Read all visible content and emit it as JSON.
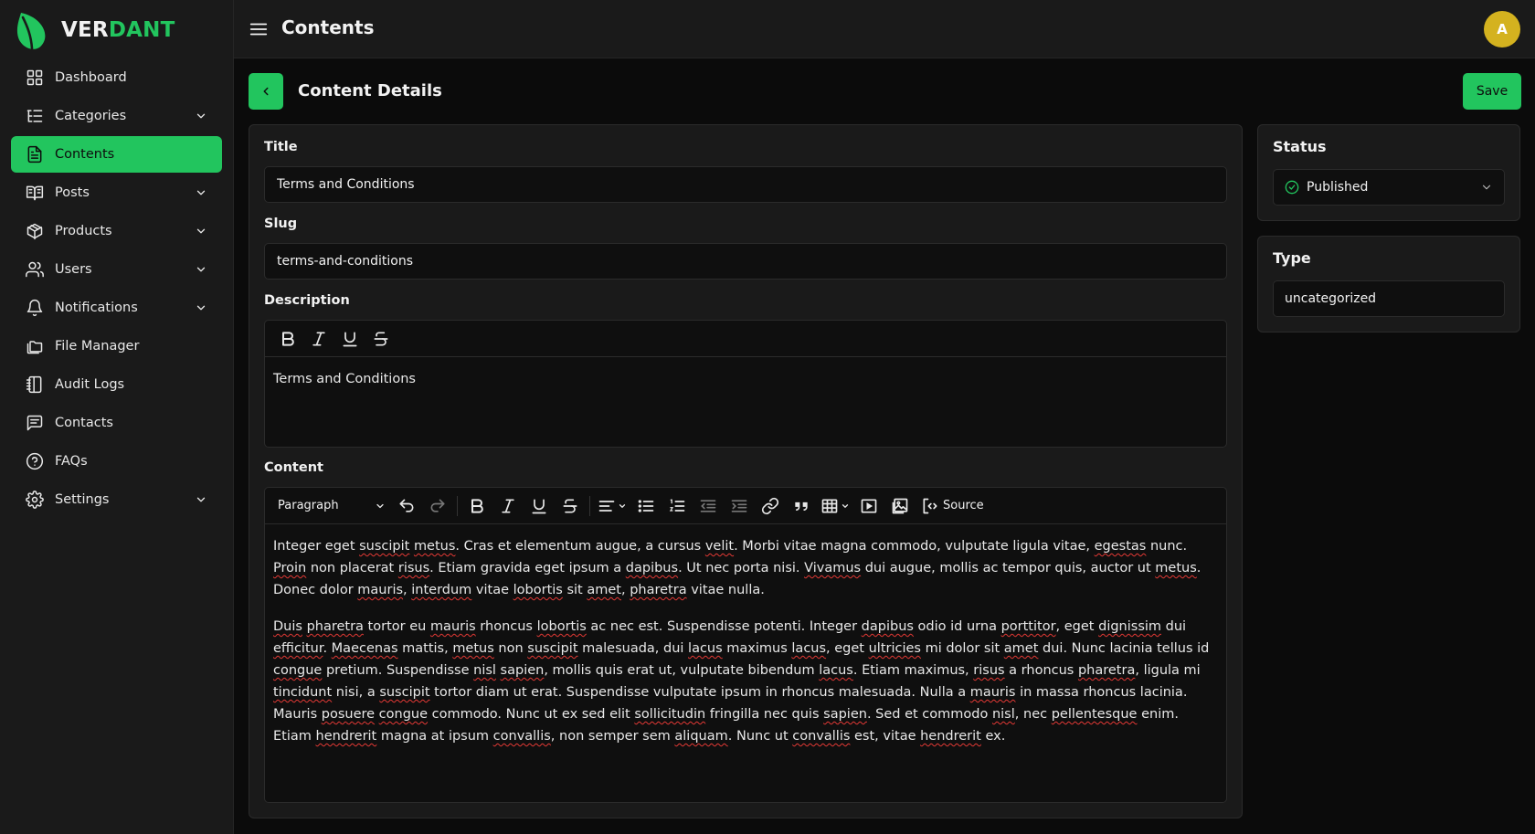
{
  "brand": {
    "prefix": "VER",
    "suffix": "DANT"
  },
  "sidebar": {
    "items": [
      {
        "label": "Dashboard",
        "icon": "grid-icon",
        "expandable": false,
        "active": false
      },
      {
        "label": "Categories",
        "icon": "list-tree-icon",
        "expandable": true,
        "active": false
      },
      {
        "label": "Contents",
        "icon": "file-text-icon",
        "expandable": false,
        "active": true
      },
      {
        "label": "Posts",
        "icon": "book-open-icon",
        "expandable": true,
        "active": false
      },
      {
        "label": "Products",
        "icon": "package-icon",
        "expandable": true,
        "active": false
      },
      {
        "label": "Users",
        "icon": "users-icon",
        "expandable": true,
        "active": false
      },
      {
        "label": "Notifications",
        "icon": "bell-icon",
        "expandable": true,
        "active": false
      },
      {
        "label": "File Manager",
        "icon": "folders-icon",
        "expandable": false,
        "active": false
      },
      {
        "label": "Audit Logs",
        "icon": "notebook-icon",
        "expandable": false,
        "active": false
      },
      {
        "label": "Contacts",
        "icon": "message-square-icon",
        "expandable": false,
        "active": false
      },
      {
        "label": "FAQs",
        "icon": "help-circle-icon",
        "expandable": false,
        "active": false
      },
      {
        "label": "Settings",
        "icon": "gear-icon",
        "expandable": true,
        "active": false
      }
    ]
  },
  "header": {
    "title": "Contents",
    "avatar_initial": "A"
  },
  "page": {
    "section_title": "Content Details",
    "save_label": "Save"
  },
  "form": {
    "title_label": "Title",
    "title_value": "Terms and Conditions",
    "slug_label": "Slug",
    "slug_value": "terms-and-conditions",
    "description_label": "Description",
    "description_value": "Terms and Conditions",
    "content_label": "Content",
    "paragraph_style": "Paragraph",
    "source_label": "Source",
    "content_paragraphs": [
      [
        [
          "Integer eget ",
          false
        ],
        [
          "suscipit",
          true
        ],
        [
          " ",
          false
        ],
        [
          "metus",
          true
        ],
        [
          ". Cras et elementum augue, a cursus ",
          false
        ],
        [
          "velit",
          true
        ],
        [
          ". Morbi vitae magna commodo, vulputate ligula vitae, ",
          false
        ],
        [
          "egestas",
          true
        ],
        [
          " nunc. ",
          false
        ],
        [
          "Proin",
          true
        ],
        [
          " non placerat ",
          false
        ],
        [
          "risus",
          true
        ],
        [
          ". Etiam gravida eget ipsum a ",
          false
        ],
        [
          "dapibus",
          true
        ],
        [
          ". Ut nec porta nisi. ",
          false
        ],
        [
          "Vivamus",
          true
        ],
        [
          " dui augue, mollis ac tempor quis, auctor ut ",
          false
        ],
        [
          "metus",
          true
        ],
        [
          ". Donec dolor ",
          false
        ],
        [
          "mauris",
          true
        ],
        [
          ", ",
          false
        ],
        [
          "interdum",
          true
        ],
        [
          " vitae ",
          false
        ],
        [
          "lobortis",
          true
        ],
        [
          " sit ",
          false
        ],
        [
          "amet",
          true
        ],
        [
          ", ",
          false
        ],
        [
          "pharetra",
          true
        ],
        [
          " vitae nulla.",
          false
        ]
      ],
      [
        [
          "Duis",
          true
        ],
        [
          " ",
          false
        ],
        [
          "pharetra",
          true
        ],
        [
          " tortor eu ",
          false
        ],
        [
          "mauris",
          true
        ],
        [
          " rhoncus ",
          false
        ],
        [
          "lobortis",
          true
        ],
        [
          " ac nec est. Suspendisse potenti. Integer ",
          false
        ],
        [
          "dapibus",
          true
        ],
        [
          " odio id urna ",
          false
        ],
        [
          "porttitor",
          true
        ],
        [
          ", eget ",
          false
        ],
        [
          "dignissim",
          true
        ],
        [
          " dui ",
          false
        ],
        [
          "efficitur",
          true
        ],
        [
          ". ",
          false
        ],
        [
          "Maecenas",
          true
        ],
        [
          " mattis, ",
          false
        ],
        [
          "metus",
          true
        ],
        [
          " non ",
          false
        ],
        [
          "suscipit",
          true
        ],
        [
          " malesuada, dui ",
          false
        ],
        [
          "lacus",
          true
        ],
        [
          " maximus ",
          false
        ],
        [
          "lacus",
          true
        ],
        [
          ", eget ",
          false
        ],
        [
          "ultricies",
          true
        ],
        [
          " mi dolor sit ",
          false
        ],
        [
          "amet",
          true
        ],
        [
          " dui. Nunc lacinia tellus id ",
          false
        ],
        [
          "congue",
          true
        ],
        [
          " pretium. Suspendisse ",
          false
        ],
        [
          "nisl",
          true
        ],
        [
          " ",
          false
        ],
        [
          "sapien",
          true
        ],
        [
          ", mollis quis erat ut, vulputate bibendum ",
          false
        ],
        [
          "lacus",
          true
        ],
        [
          ". Etiam maximus, ",
          false
        ],
        [
          "risus",
          true
        ],
        [
          " a rhoncus ",
          false
        ],
        [
          "pharetra",
          true
        ],
        [
          ", ligula mi ",
          false
        ],
        [
          "tincidunt",
          true
        ],
        [
          " nisi, a ",
          false
        ],
        [
          "suscipit",
          true
        ],
        [
          " tortor diam ut erat. Suspendisse vulputate ipsum in rhoncus malesuada. Nulla a ",
          false
        ],
        [
          "mauris",
          true
        ],
        [
          " in massa rhoncus lacinia. Mauris ",
          false
        ],
        [
          "posuere",
          true
        ],
        [
          " ",
          false
        ],
        [
          "congue",
          true
        ],
        [
          " commodo. Nunc ut ex sed elit ",
          false
        ],
        [
          "sollicitudin",
          true
        ],
        [
          " fringilla nec quis ",
          false
        ],
        [
          "sapien",
          true
        ],
        [
          ". Sed et commodo ",
          false
        ],
        [
          "nisl",
          true
        ],
        [
          ", nec ",
          false
        ],
        [
          "pellentesque",
          true
        ],
        [
          " enim. Etiam ",
          false
        ],
        [
          "hendrerit",
          true
        ],
        [
          " magna at ipsum ",
          false
        ],
        [
          "convallis",
          true
        ],
        [
          ", non semper sem ",
          false
        ],
        [
          "aliquam",
          true
        ],
        [
          ". Nunc ut ",
          false
        ],
        [
          "convallis",
          true
        ],
        [
          " est, vitae ",
          false
        ],
        [
          "hendrerit",
          true
        ],
        [
          " ex.",
          false
        ]
      ]
    ]
  },
  "status": {
    "label": "Status",
    "value": "Published"
  },
  "type": {
    "label": "Type",
    "value": "uncategorized"
  },
  "colors": {
    "accent": "#22c55e",
    "avatar": "#d4b21f",
    "background": "#0b0b0b",
    "panel": "#1a1a1a"
  }
}
